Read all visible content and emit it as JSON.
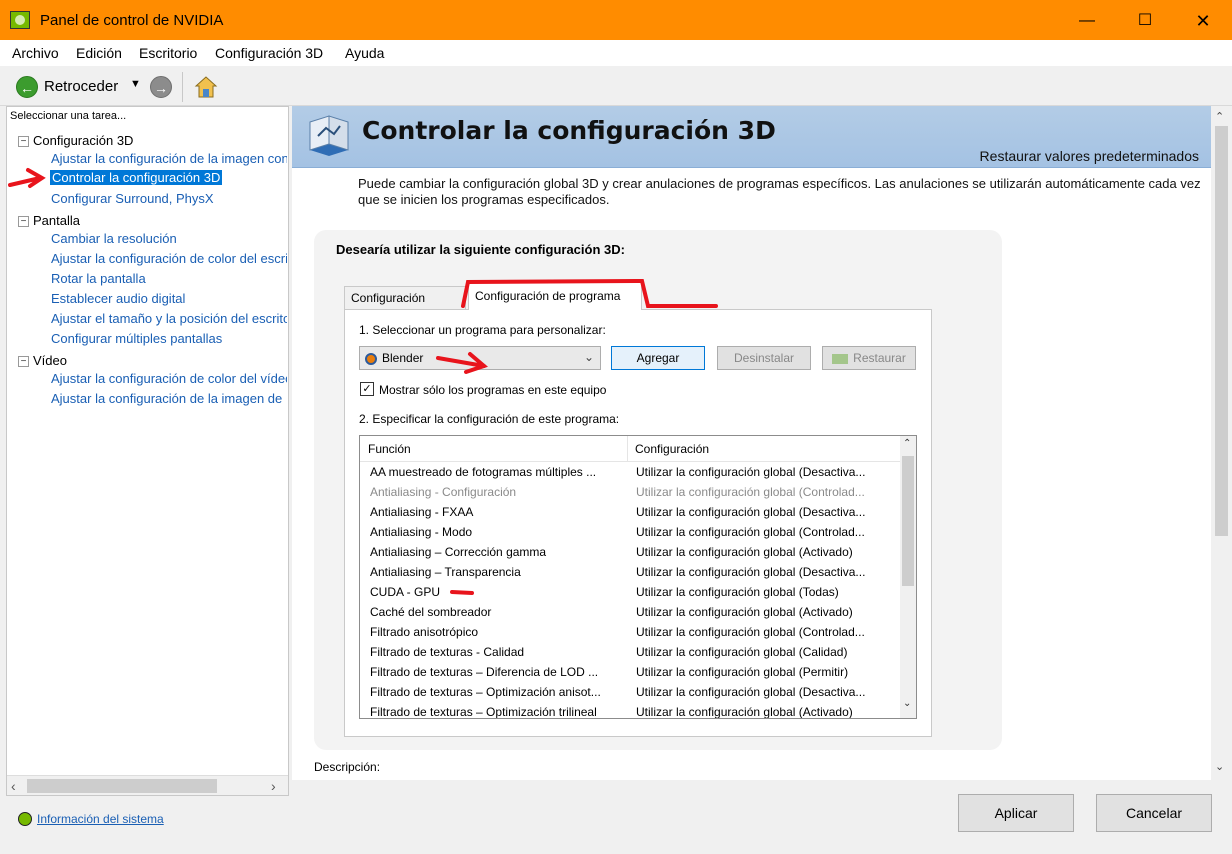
{
  "window": {
    "title": "Panel de control de NVIDIA",
    "min_glyph": "—",
    "max_glyph": "☐",
    "close_glyph": "✕"
  },
  "menu": [
    "Archivo",
    "Edición",
    "Escritorio",
    "Configuración 3D",
    "Ayuda"
  ],
  "toolbar": {
    "back_label": "Retroceder",
    "back_glyph": "←",
    "forward_glyph": "→",
    "dropdown_glyph": "▼"
  },
  "sidebar": {
    "task_label": "Seleccionar una tarea...",
    "categories": [
      {
        "label": "Configuración 3D",
        "items": [
          "Ajustar la configuración de la imagen con vista previa",
          "Controlar la configuración 3D",
          "Configurar Surround, PhysX"
        ]
      },
      {
        "label": "Pantalla",
        "items": [
          "Cambiar la resolución",
          "Ajustar la configuración de color del escritorio",
          "Rotar la pantalla",
          "Establecer audio digital",
          "Ajustar el tamaño y la posición del escritorio",
          "Configurar múltiples pantallas"
        ]
      },
      {
        "label": "Vídeo",
        "items": [
          "Ajustar la configuración de color del vídeo",
          "Ajustar la configuración de la imagen de vídeo"
        ]
      }
    ],
    "selected_item": "Controlar la configuración 3D",
    "collapse_glyph": "−",
    "system_info": "Información del sistema"
  },
  "header": {
    "title": "Controlar la configuración 3D",
    "restore_defaults": "Restaurar valores predeterminados"
  },
  "intro": "Puede cambiar la configuración global 3D y crear anulaciones de programas específicos. Las anulaciones se utilizarán automáticamente cada vez que se inicien los programas especificados.",
  "settings": {
    "group_title": "Desearía utilizar la siguiente configuración 3D:",
    "tabs": [
      "Configuración global",
      "Configuración de programa"
    ],
    "active_tab": "Configuración de programa",
    "step1": "1. Seleccionar un programa para personalizar:",
    "program": "Blender",
    "combo_caret": "⌄",
    "add": "Agregar",
    "uninstall": "Desinstalar",
    "restore": "Restaurar",
    "show_only_label": "Mostrar sólo los programas en este equipo",
    "show_only_checked": true,
    "check_glyph": "✓",
    "step2": "2. Especificar la configuración de este programa:",
    "columns": [
      "Función",
      "Configuración"
    ],
    "rows": [
      {
        "feature": "AA muestreado de fotogramas múltiples ...",
        "setting": "Utilizar la configuración global (Desactiva...",
        "dim": false
      },
      {
        "feature": "Antialiasing - Configuración",
        "setting": "Utilizar la configuración global (Controlad...",
        "dim": true
      },
      {
        "feature": "Antialiasing - FXAA",
        "setting": "Utilizar la configuración global (Desactiva...",
        "dim": false
      },
      {
        "feature": "Antialiasing - Modo",
        "setting": "Utilizar la configuración global (Controlad...",
        "dim": false
      },
      {
        "feature": "Antialiasing – Corrección gamma",
        "setting": "Utilizar la configuración global (Activado)",
        "dim": false
      },
      {
        "feature": "Antialiasing – Transparencia",
        "setting": "Utilizar la configuración global (Desactiva...",
        "dim": false
      },
      {
        "feature": "CUDA - GPU",
        "setting": "Utilizar la configuración global (Todas)",
        "dim": false
      },
      {
        "feature": "Caché del sombreador",
        "setting": "Utilizar la configuración global (Activado)",
        "dim": false
      },
      {
        "feature": "Filtrado anisotrópico",
        "setting": "Utilizar la configuración global (Controlad...",
        "dim": false
      },
      {
        "feature": "Filtrado de texturas - Calidad",
        "setting": "Utilizar la configuración global (Calidad)",
        "dim": false
      },
      {
        "feature": "Filtrado de texturas – Diferencia de LOD ...",
        "setting": "Utilizar la configuración global (Permitir)",
        "dim": false
      },
      {
        "feature": "Filtrado de texturas – Optimización anisot...",
        "setting": "Utilizar la configuración global (Desactiva...",
        "dim": false
      },
      {
        "feature": "Filtrado de texturas – Optimización trilineal",
        "setting": "Utilizar la configuración global (Activado)",
        "dim": false
      }
    ],
    "scroll_up_glyph": "⌃",
    "scroll_down_glyph": "⌄"
  },
  "description_label": "Descripción:",
  "footer": {
    "apply": "Aplicar",
    "cancel": "Cancelar"
  },
  "colors": {
    "titlebar": "#ff8c00",
    "selection": "#0078d7",
    "link": "#1a5fb4",
    "header_band": "#a4c2e3",
    "annotation": "#e8141c"
  }
}
